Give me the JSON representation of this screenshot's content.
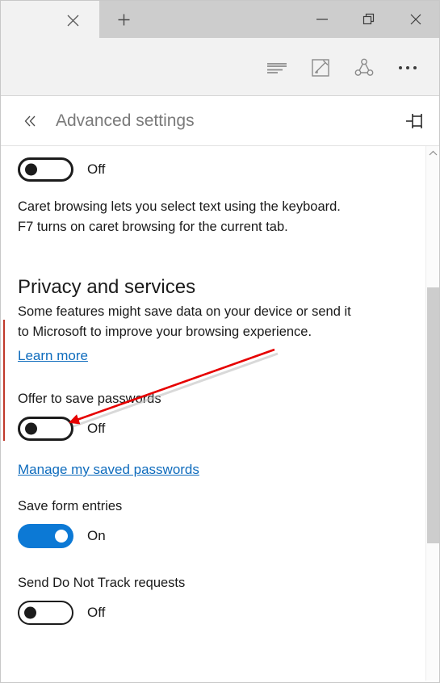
{
  "window": {
    "tab_close_icon": "close-icon",
    "new_tab_icon": "plus-icon",
    "minimize_icon": "minimize-icon",
    "restore_icon": "restore-icon",
    "close_icon": "close-icon"
  },
  "commandbar": {
    "reading_view_icon": "reading-view-icon",
    "web_note_icon": "web-note-icon",
    "share_icon": "share-icon",
    "more_icon": "more-ellipsis-icon"
  },
  "pane": {
    "back_icon": "double-chevron-left-icon",
    "title": "Advanced settings",
    "pin_icon": "pin-icon"
  },
  "settings": {
    "caret_browsing": {
      "toggle_state": "Off",
      "description_line1": "Caret browsing lets you select text using the keyboard.",
      "description_line2": "F7 turns on caret browsing for the current tab."
    },
    "privacy": {
      "section_title": "Privacy and services",
      "description_line1": "Some features might save data on your device or send it",
      "description_line2": "to Microsoft to improve your browsing experience.",
      "learn_more": "Learn more"
    },
    "offer_to_save_passwords": {
      "label": "Offer to save passwords",
      "toggle_state": "Off",
      "manage_link": "Manage my saved passwords"
    },
    "save_form_entries": {
      "label": "Save form entries",
      "toggle_state": "On"
    },
    "do_not_track": {
      "label": "Send Do Not Track requests",
      "toggle_state": "Off"
    }
  },
  "scrollbar": {
    "up_arrow_icon": "chevron-up-icon"
  },
  "annotation": {
    "arrow_color": "#e60000",
    "marker_color": "#c0392b"
  },
  "colors": {
    "accent": "#0c79d5",
    "link": "#0f6cbd",
    "text": "#1a1a1a",
    "title_gray": "#7a7a7a"
  }
}
